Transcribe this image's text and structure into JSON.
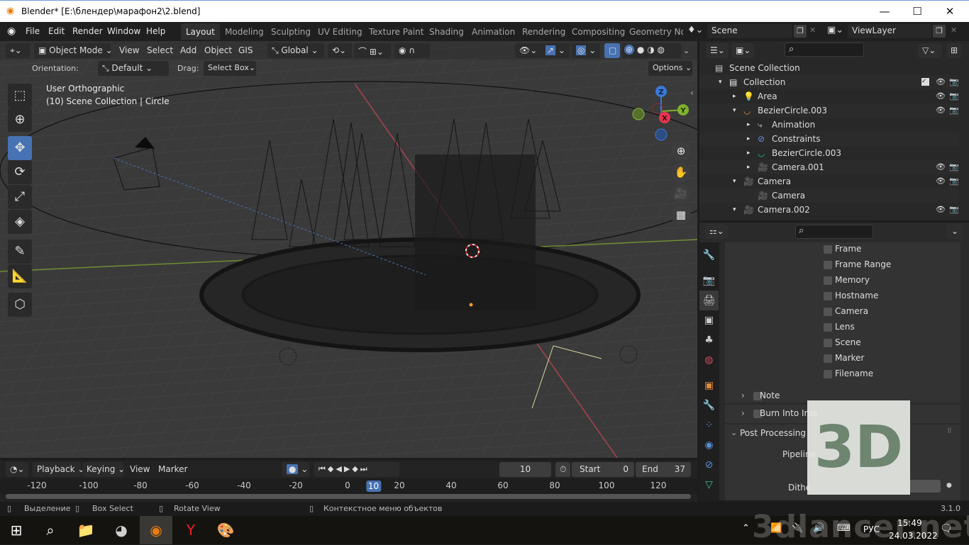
{
  "window": {
    "title": "Blender* [E:\\блендер\\марафон2\\2.blend]",
    "minimize": "—",
    "maximize": "☐",
    "close": "✕"
  },
  "menu": [
    "File",
    "Edit",
    "Render",
    "Window",
    "Help"
  ],
  "workspaces": [
    "Layout",
    "Modeling",
    "Sculpting",
    "UV Editing",
    "Texture Paint",
    "Shading",
    "Animation",
    "Rendering",
    "Compositing",
    "Geometry No"
  ],
  "active_workspace": "Layout",
  "scene_field": "Scene",
  "viewlayer_field": "ViewLayer",
  "viewport": {
    "mode": "Object Mode",
    "menus": [
      "View",
      "Select",
      "Add",
      "Object",
      "GIS"
    ],
    "transform_orientation": "Global",
    "orientation_label": "Orientation:",
    "orientation_value": "Default",
    "drag_label": "Drag:",
    "drag_value": "Select Box",
    "options_label": "Options",
    "view_name": "User Orthographic",
    "view_info": "(10) Scene Collection | Circle",
    "gizmo": {
      "x": "X",
      "y": "Y",
      "z": "Z"
    },
    "tools": [
      "select-box",
      "cursor",
      "move",
      "rotate",
      "scale",
      "transform",
      "annotate",
      "measure",
      "add-cube"
    ],
    "active_tool": "move"
  },
  "outliner": {
    "search_placeholder": "",
    "rows": [
      {
        "label": "Scene Collection",
        "depth": 0,
        "icon": "scene-collection",
        "expand": "",
        "vis": false
      },
      {
        "label": "Collection",
        "depth": 1,
        "icon": "collection",
        "expand": "▾",
        "vis": true,
        "check": true
      },
      {
        "label": "Area",
        "depth": 2,
        "icon": "light",
        "expand": "▸",
        "vis": true
      },
      {
        "label": "BezierCircle.003",
        "depth": 2,
        "icon": "curve",
        "expand": "▾",
        "vis": true
      },
      {
        "label": "Animation",
        "depth": 3,
        "icon": "animation",
        "expand": "▸",
        "vis": false
      },
      {
        "label": "Constraints",
        "depth": 3,
        "icon": "constraint",
        "expand": "▸",
        "vis": false
      },
      {
        "label": "BezierCircle.003",
        "depth": 3,
        "icon": "curve-data",
        "expand": "▸",
        "vis": false
      },
      {
        "label": "Camera.001",
        "depth": 3,
        "icon": "camera",
        "expand": "▸",
        "vis": true
      },
      {
        "label": "Camera",
        "depth": 2,
        "icon": "camera",
        "expand": "▾",
        "vis": true
      },
      {
        "label": "Camera",
        "depth": 3,
        "icon": "camera-data",
        "expand": "",
        "vis": false
      },
      {
        "label": "Camera.002",
        "depth": 2,
        "icon": "camera",
        "expand": "▾",
        "vis": true
      }
    ]
  },
  "properties": {
    "metadata_items": [
      "Frame",
      "Frame Range",
      "Memory",
      "Hostname",
      "Camera",
      "Lens",
      "Scene",
      "Marker",
      "Filename"
    ],
    "subpanels": [
      "Note",
      "Burn Into Ima"
    ],
    "panel_post_processing": "Post Processing",
    "pipeline_label": "Pipeline",
    "dither_label": "Dithe"
  },
  "timeline": {
    "menus": [
      "Playback",
      "Keying",
      "View",
      "Marker"
    ],
    "current_frame": "10",
    "start_label": "Start",
    "start_value": "0",
    "end_label": "End",
    "end_value": "37",
    "ticks": [
      "-120",
      "-100",
      "-80",
      "-60",
      "-40",
      "-20",
      "0",
      "10",
      "20",
      "40",
      "60",
      "80",
      "100",
      "120"
    ]
  },
  "statusbar": {
    "select": "Выделение",
    "box_select": "Box Select",
    "rotate_view": "Rotate View",
    "context_menu": "Контекстное меню объектов",
    "version": "3.1.0"
  },
  "taskbar": {
    "lang": "РУС",
    "time": "15:49",
    "date": "24.03.2022"
  },
  "watermark": {
    "badge": "3D",
    "text": "3dlancer.net"
  }
}
